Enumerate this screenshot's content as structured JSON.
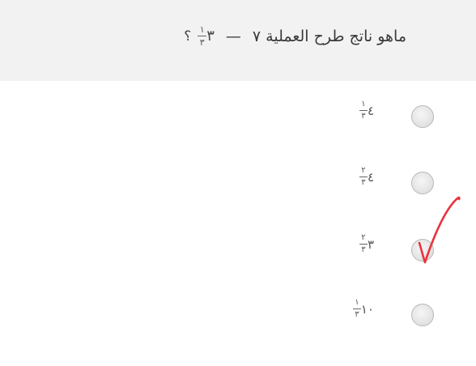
{
  "question": {
    "prefix": "ماهو ناتج طرح العملية ٧",
    "minus": "—",
    "operand_whole": "٣",
    "operand_num": "١",
    "operand_den": "٣",
    "qmark": "؟"
  },
  "options": [
    {
      "whole": "٤",
      "num": "١",
      "den": "٣",
      "selected": false
    },
    {
      "whole": "٤",
      "num": "٢",
      "den": "٣",
      "selected": false
    },
    {
      "whole": "٣",
      "num": "٢",
      "den": "٣",
      "selected": true
    },
    {
      "whole": "١٠",
      "num": "١",
      "den": "٣",
      "selected": false
    }
  ],
  "colors": {
    "question_bar": "#f2f2f2",
    "checkmark": "#e8343f"
  },
  "icons": {
    "checkmark": "handwritten-checkmark-icon"
  }
}
